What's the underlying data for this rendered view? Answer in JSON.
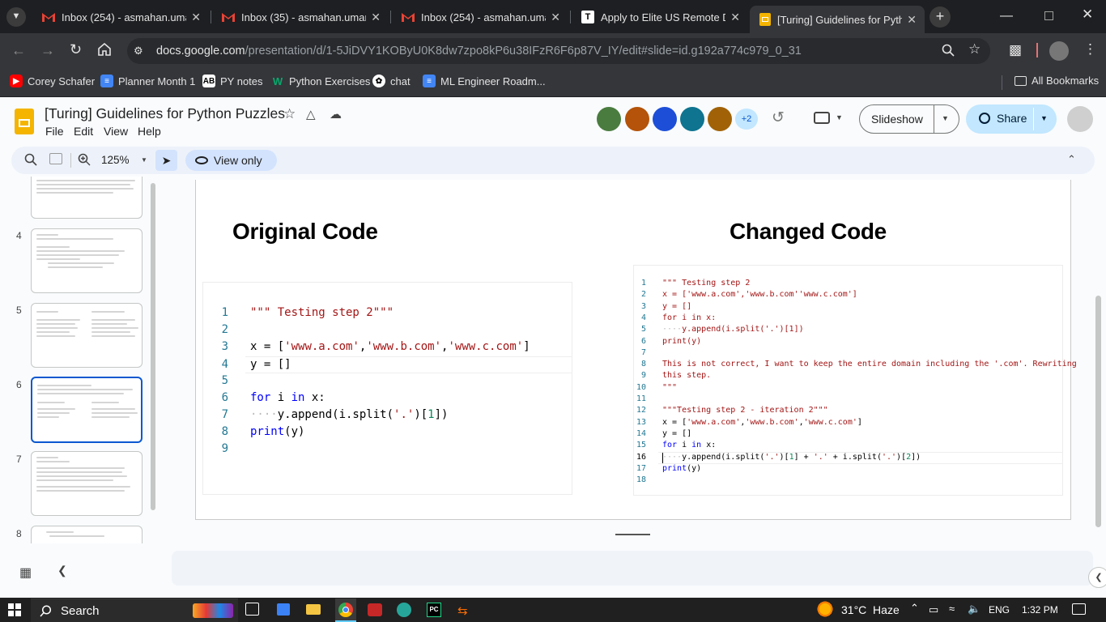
{
  "browser": {
    "tabs": [
      {
        "title": "Inbox (254) - asmahan.umar",
        "icon": "gmail-icon",
        "active": false
      },
      {
        "title": "Inbox (35) - asmahan.umar@",
        "icon": "gmail-icon",
        "active": false
      },
      {
        "title": "Inbox (254) - asmahan.umar",
        "icon": "gmail-icon",
        "active": false
      },
      {
        "title": "Apply to Elite US Remote De",
        "icon": "turing-icon",
        "active": false
      },
      {
        "title": "[Turing] Guidelines for Pytho",
        "icon": "slides-icon",
        "active": true
      }
    ],
    "url_domain": "docs.google.com",
    "url_path": "/presentation/d/1-5JiDVY1KOByU0K8dw7zpo8kP6u38IFzR6F6p87V_IY/edit#slide=id.g192a774c979_0_31",
    "bookmarks": [
      {
        "label": "Corey Schafer",
        "icon": "youtube-icon",
        "color": "#ff0000"
      },
      {
        "label": "Planner Month 1",
        "icon": "docs-icon",
        "color": "#4285f4"
      },
      {
        "label": "PY notes",
        "icon": "ab-icon",
        "color": "#ffffff"
      },
      {
        "label": "Python Exercises",
        "icon": "w3-icon",
        "color": "#04aa6d"
      },
      {
        "label": "chat",
        "icon": "openai-icon",
        "color": "#ffffff"
      },
      {
        "label": "ML Engineer Roadm...",
        "icon": "docs-icon",
        "color": "#4285f4"
      }
    ],
    "all_bookmarks": "All Bookmarks"
  },
  "doc": {
    "title": "[Turing] Guidelines for Python Puzzles",
    "menus": [
      "File",
      "Edit",
      "View",
      "Help"
    ],
    "more_users": "+2",
    "slideshow_label": "Slideshow",
    "share_label": "Share",
    "zoom": "125%",
    "view_only": "View only"
  },
  "filmstrip": [
    "4",
    "5",
    "6",
    "7",
    "8"
  ],
  "slide": {
    "left_heading": "Original Code",
    "right_heading": "Changed Code",
    "left_code_numbers": [
      "1",
      "2",
      "3",
      "4",
      "5",
      "6",
      "7",
      "8",
      "9"
    ],
    "right_code_numbers": [
      "1",
      "2",
      "3",
      "4",
      "5",
      "6",
      "7",
      "8",
      "9",
      "10",
      "11",
      "12",
      "13",
      "14",
      "15",
      "16",
      "17",
      "18"
    ]
  },
  "taskbar": {
    "search": "Search",
    "weather": "31°C  Haze",
    "lang": "ENG",
    "time": "1:32 PM"
  },
  "colors": {
    "accent": "#0b57d0",
    "share_bg": "#c2e7ff"
  }
}
